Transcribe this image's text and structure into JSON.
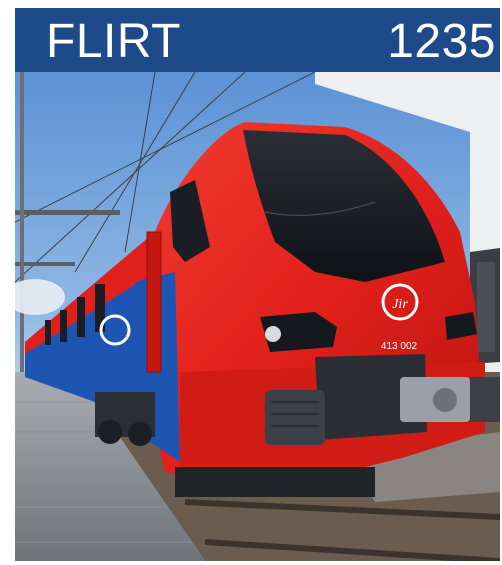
{
  "header": {
    "name": "FLIRT",
    "number": "1235",
    "background_color": "#1d4b8a",
    "text_color": "#ffffff"
  },
  "photo": {
    "train_number": "413 002",
    "logo_text": "Jir",
    "colors": {
      "body_red": "#e0201b",
      "body_blue": "#1e55b3",
      "sky": "#6f9fd8"
    }
  }
}
